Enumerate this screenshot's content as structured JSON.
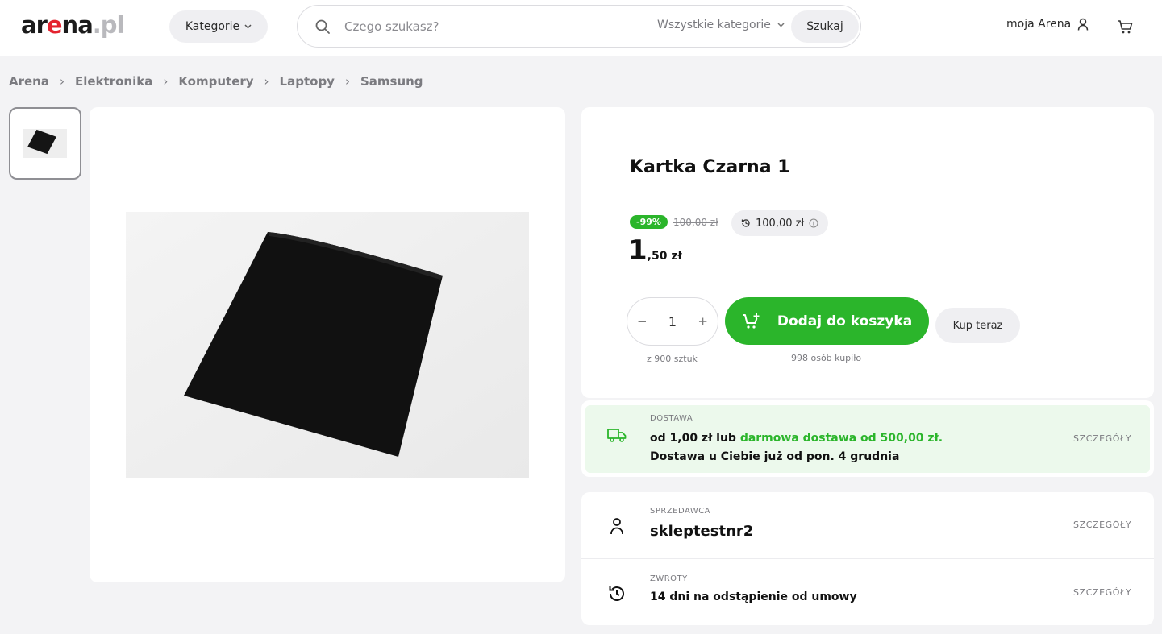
{
  "header": {
    "logo": {
      "part1": "ar",
      "part2": "e",
      "part3": "na",
      "part4": ".pl"
    },
    "categories_button": "Kategorie",
    "search": {
      "placeholder": "Czego szukasz?",
      "category": "Wszystkie kategorie",
      "button": "Szukaj"
    },
    "account": "moja Arena"
  },
  "breadcrumb": [
    "Arena",
    "Elektronika",
    "Komputery",
    "Laptopy",
    "Samsung"
  ],
  "breadcrumb_separator": "›",
  "product": {
    "title": "Kartka Czarna 1",
    "discount": "-99%",
    "old_price": "100,00 zł",
    "lowest_price": "100,00 zł",
    "price_int": "1",
    "price_frac": ",50 zł",
    "quantity": "1",
    "qty_minus": "−",
    "qty_plus": "+",
    "stock": "z 900 sztuk",
    "add_to_cart": "Dodaj do koszyka",
    "bought": "998 osób kupiło",
    "buy_now": "Kup teraz"
  },
  "delivery": {
    "label": "DOSTAWA",
    "line1_prefix": "od 1,00 zł lub ",
    "line1_green": "darmowa dostawa od 500,00 zł.",
    "line2": "Dostawa u Ciebie już od pon. 4 grudnia",
    "details": "SZCZEGÓŁY"
  },
  "seller": {
    "label": "SPRZEDAWCA",
    "name": "skleptestnr2",
    "details": "SZCZEGÓŁY"
  },
  "returns": {
    "label": "ZWROTY",
    "text": "14 dni na odstąpienie od umowy",
    "details": "SZCZEGÓŁY"
  },
  "colors": {
    "accent_green": "#2bb52b",
    "logo_red": "#e4222e",
    "background": "#f3f3f5"
  },
  "icons": [
    "search-icon",
    "chevron-down-icon",
    "user-icon",
    "cart-icon",
    "add-to-cart-icon",
    "history-icon",
    "info-icon",
    "truck-icon",
    "seller-icon",
    "returns-icon"
  ]
}
